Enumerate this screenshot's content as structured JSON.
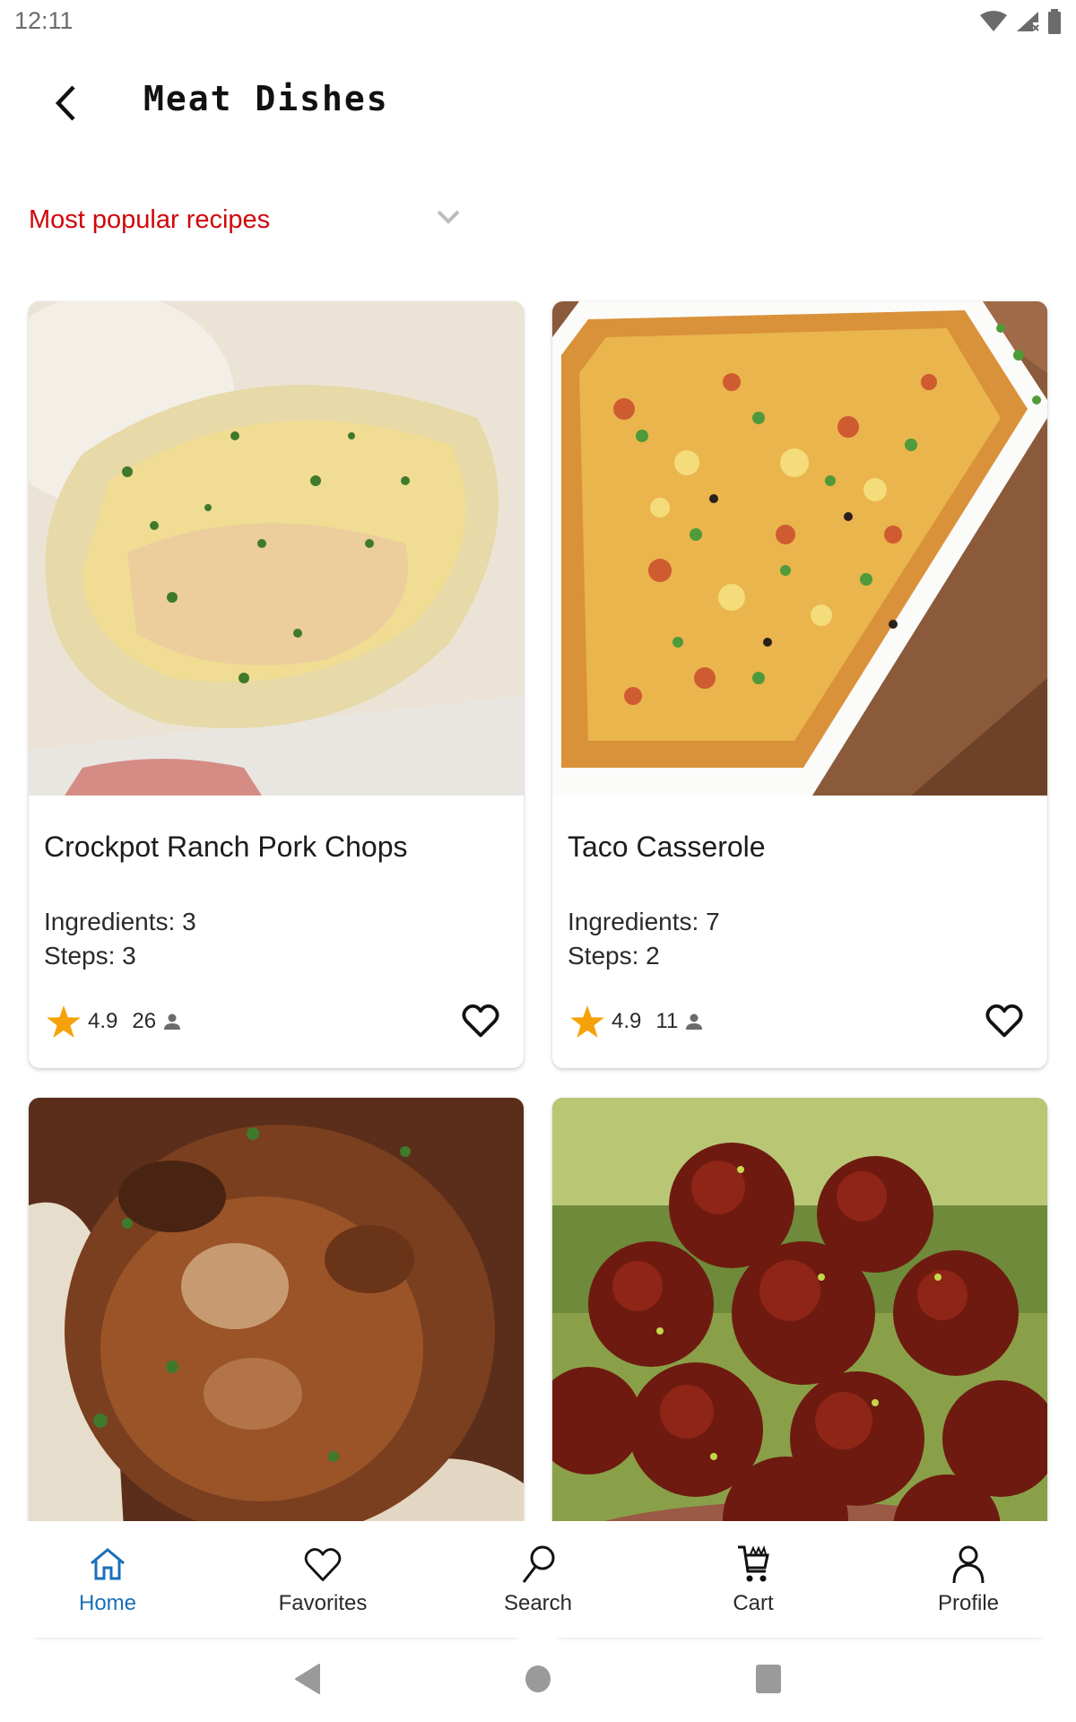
{
  "status_bar": {
    "time": "12:11",
    "icons": [
      "wifi-icon",
      "signal-no-data-icon",
      "battery-icon"
    ]
  },
  "header": {
    "back_icon": "chevron-left-icon",
    "title": "Meat Dishes"
  },
  "sort": {
    "selected": "Most popular recipes",
    "icon": "chevron-down-icon",
    "accent_color": "#d0070b"
  },
  "recipes": [
    {
      "title": "Crockpot Ranch Pork Chops",
      "ingredients": "Ingredients: 3",
      "steps": "Steps: 3",
      "rating": "4.9",
      "reviews": "26",
      "image_desc": "Pork chops covered in creamy ranch gravy with parsley over mashed potatoes"
    },
    {
      "title": "Taco Casserole",
      "ingredients": "Ingredients: 7",
      "steps": "Steps: 2",
      "rating": "4.9",
      "reviews": "11",
      "image_desc": "Cheesy taco casserole in a white baking dish topped with green onions"
    },
    {
      "title": "",
      "image_desc": "Salisbury steak with mushroom gravy over rice"
    },
    {
      "title": "",
      "image_desc": "Glazed meatballs garnished with lime zest"
    }
  ],
  "bottom_nav": {
    "active_color": "#1a6fb8",
    "items": [
      {
        "label": "Home",
        "icon": "home-icon",
        "active": true
      },
      {
        "label": "Favorites",
        "icon": "heart-icon",
        "active": false
      },
      {
        "label": "Search",
        "icon": "search-icon",
        "active": false
      },
      {
        "label": "Cart",
        "icon": "cart-icon",
        "active": false
      },
      {
        "label": "Profile",
        "icon": "profile-icon",
        "active": false
      }
    ]
  },
  "system_nav": [
    "back-triangle-icon",
    "home-circle-icon",
    "recents-square-icon"
  ]
}
